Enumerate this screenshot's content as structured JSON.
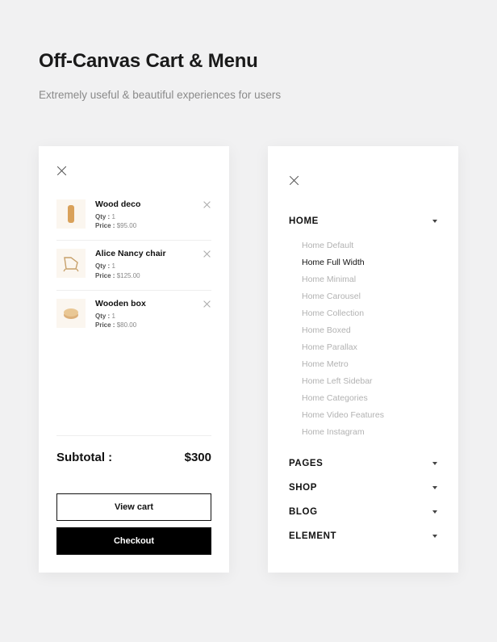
{
  "header": {
    "title": "Off-Canvas Cart & Menu",
    "subtitle": "Extremely useful & beautiful experiences for users"
  },
  "cart": {
    "qty_label": "Qty :",
    "price_label": "Price :",
    "items": [
      {
        "name": "Wood deco",
        "qty": "1",
        "price": "$95.00"
      },
      {
        "name": "Alice Nancy chair",
        "qty": "1",
        "price": "$125.00"
      },
      {
        "name": "Wooden box",
        "qty": "1",
        "price": "$80.00"
      }
    ],
    "subtotal_label": "Subtotal :",
    "subtotal_value": "$300",
    "view_cart_label": "View cart",
    "checkout_label": "Checkout"
  },
  "menu": {
    "sections": [
      {
        "label": "HOME"
      },
      {
        "label": "PAGES"
      },
      {
        "label": "SHOP"
      },
      {
        "label": "BLOG"
      },
      {
        "label": "ELEMENT"
      }
    ],
    "home_items": [
      {
        "label": "Home Default",
        "active": false
      },
      {
        "label": "Home Full Width",
        "active": true
      },
      {
        "label": "Home Minimal",
        "active": false
      },
      {
        "label": "Home Carousel",
        "active": false
      },
      {
        "label": "Home Collection",
        "active": false
      },
      {
        "label": "Home Boxed",
        "active": false
      },
      {
        "label": "Home Parallax",
        "active": false
      },
      {
        "label": "Home Metro",
        "active": false
      },
      {
        "label": "Home Left Sidebar",
        "active": false
      },
      {
        "label": "Home Categories",
        "active": false
      },
      {
        "label": "Home Video Features",
        "active": false
      },
      {
        "label": "Home Instagram",
        "active": false
      }
    ]
  }
}
